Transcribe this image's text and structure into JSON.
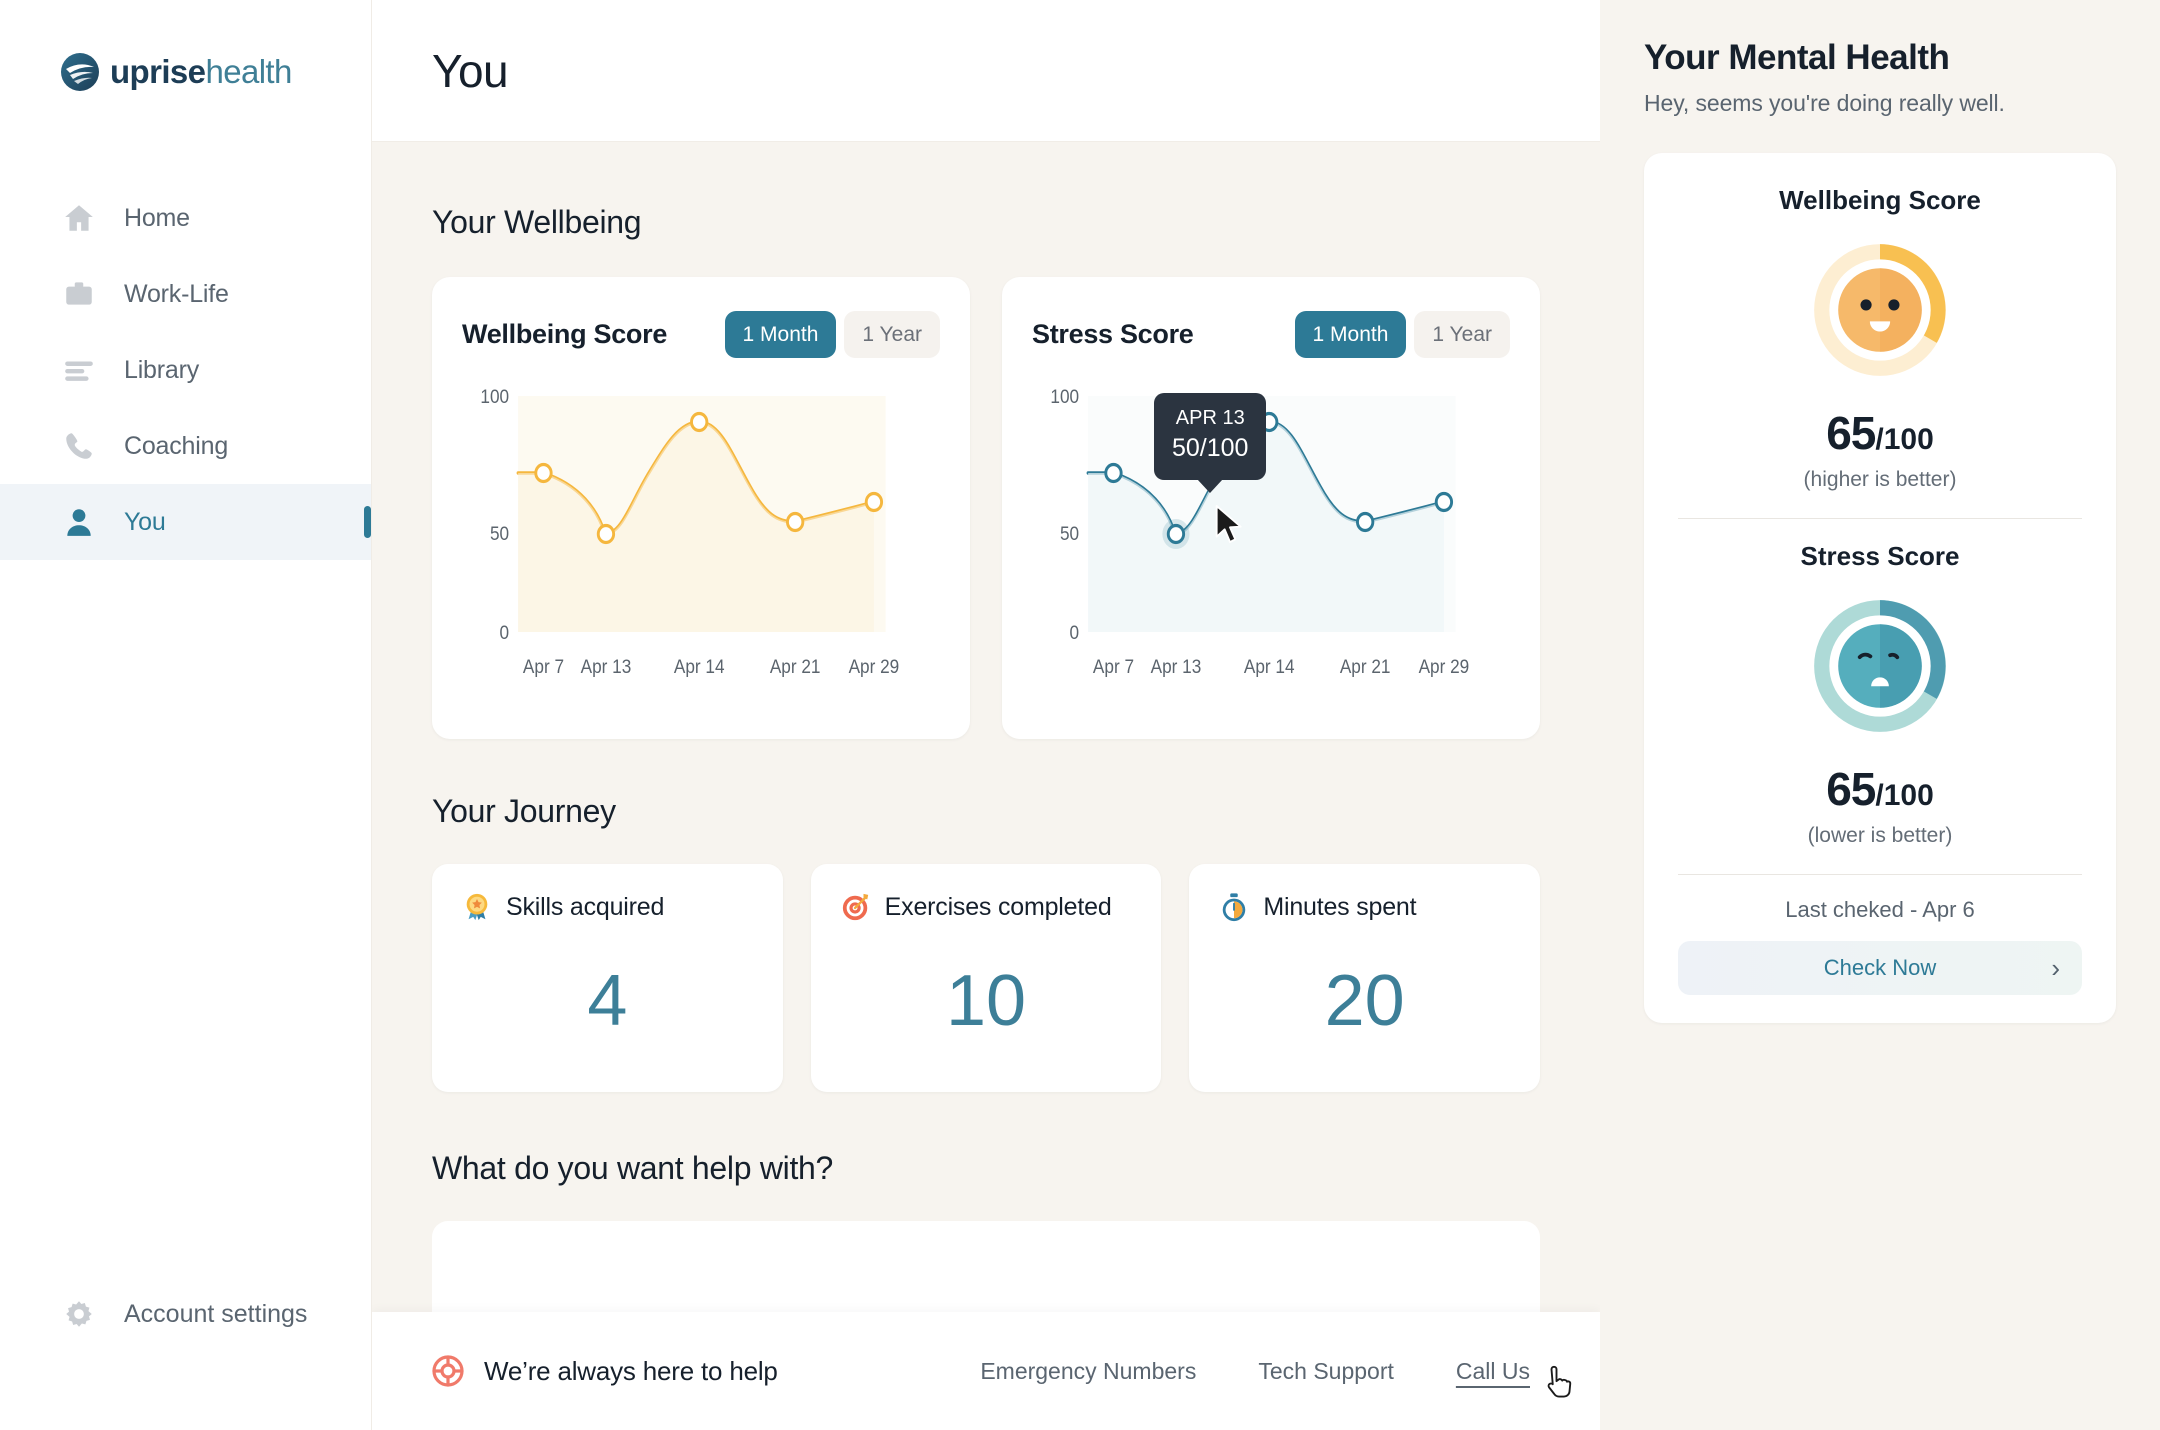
{
  "brand": {
    "name_bold": "uprise",
    "name_light": "health",
    "logo_icon": "uprise-logo-icon",
    "teal": "#2d7a96",
    "orange": "#f5b73e",
    "background": "#f7f4ef"
  },
  "sidebar": {
    "items": [
      {
        "label": "Home",
        "icon": "home-icon",
        "active": false
      },
      {
        "label": "Work-Life",
        "icon": "briefcase-icon",
        "active": false
      },
      {
        "label": "Library",
        "icon": "library-lines-icon",
        "active": false
      },
      {
        "label": "Coaching",
        "icon": "phone-icon",
        "active": false
      },
      {
        "label": "You",
        "icon": "person-icon",
        "active": true
      }
    ],
    "settings": {
      "label": "Account settings",
      "icon": "gear-icon"
    }
  },
  "header": {
    "title": "You"
  },
  "main": {
    "wellbeing_section_title": "Your Wellbeing",
    "journey_section_title": "Your Journey",
    "help_section_title": "What do you want help with?",
    "range_tabs": {
      "month": "1 Month",
      "year": "1 Year",
      "selected": "1 Month"
    },
    "journey_cards": [
      {
        "label": "Skills acquired",
        "value": "4",
        "icon": "medal-icon"
      },
      {
        "label": "Exercises completed",
        "value": "10",
        "icon": "target-icon"
      },
      {
        "label": "Minutes spent",
        "value": "20",
        "icon": "stopwatch-icon"
      }
    ]
  },
  "chart_data": [
    {
      "type": "line",
      "title": "Wellbeing Score",
      "categories": [
        "Apr 7",
        "Apr 13",
        "Apr 14",
        "Apr 21",
        "Apr 29"
      ],
      "values": [
        72,
        50,
        95,
        57,
        67
      ],
      "yticks": [
        "0",
        "50",
        "100"
      ],
      "ylim": [
        0,
        100
      ],
      "xlabel": "",
      "ylabel": "",
      "grid": false,
      "legend": "none",
      "color": "#f5b73e",
      "fill": "#fdf6e4",
      "range_selected": "1 Month"
    },
    {
      "type": "line",
      "title": "Stress Score",
      "categories": [
        "Apr 7",
        "Apr 13",
        "Apr 14",
        "Apr 21",
        "Apr 29"
      ],
      "values": [
        72,
        50,
        95,
        57,
        67
      ],
      "yticks": [
        "0",
        "50",
        "100"
      ],
      "ylim": [
        0,
        100
      ],
      "xlabel": "",
      "ylabel": "",
      "grid": false,
      "legend": "none",
      "color": "#2d7a96",
      "fill": "#f2f7f8",
      "range_selected": "1 Month",
      "tooltip": {
        "date": "APR 13",
        "value": "50/100",
        "point_index": 1
      }
    }
  ],
  "right_panel": {
    "title": "Your Mental Health",
    "subtitle": "Hey, seems you're doing really well.",
    "wellbeing": {
      "title": "Wellbeing Score",
      "score": "65",
      "denominator": "/100",
      "note": "(higher is better)",
      "gauge_percent": 65,
      "gauge_color": "#f8c051",
      "gauge_track": "#fdeccd",
      "face_icon": "happy-face-icon"
    },
    "stress": {
      "title": "Stress Score",
      "score": "65",
      "denominator": "/100",
      "note": "(lower is better)",
      "gauge_percent": 65,
      "gauge_color": "#4f9cb0",
      "gauge_track": "#aedad7",
      "face_icon": "sad-face-icon"
    },
    "last_checked": "Last cheked - Apr 6",
    "check_button": {
      "label": "Check Now",
      "icon": "chevron-right-icon"
    }
  },
  "footer": {
    "title": "We’re always here to help",
    "icon": "lifebuoy-icon",
    "links": [
      "Emergency Numbers",
      "Tech Support",
      "Call Us"
    ]
  }
}
